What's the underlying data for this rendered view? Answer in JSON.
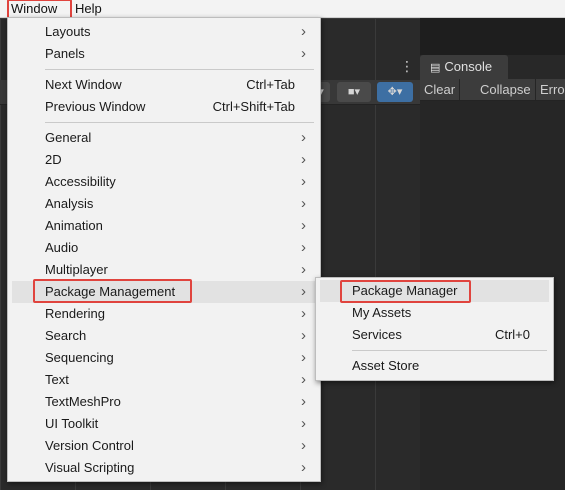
{
  "menubar": {
    "items": [
      "Window",
      "Help"
    ]
  },
  "window_menu": {
    "groups": [
      [
        {
          "label": "Layouts",
          "submenu": true
        },
        {
          "label": "Panels",
          "submenu": true
        }
      ],
      [
        {
          "label": "Next Window",
          "shortcut": "Ctrl+Tab"
        },
        {
          "label": "Previous Window",
          "shortcut": "Ctrl+Shift+Tab"
        }
      ],
      [
        {
          "label": "General",
          "submenu": true
        },
        {
          "label": "2D",
          "submenu": true
        },
        {
          "label": "Accessibility",
          "submenu": true
        },
        {
          "label": "Analysis",
          "submenu": true
        },
        {
          "label": "Animation",
          "submenu": true
        },
        {
          "label": "Audio",
          "submenu": true
        },
        {
          "label": "Multiplayer",
          "submenu": true
        },
        {
          "label": "Package Management",
          "submenu": true,
          "highlighted": true
        },
        {
          "label": "Rendering",
          "submenu": true
        },
        {
          "label": "Search",
          "submenu": true
        },
        {
          "label": "Sequencing",
          "submenu": true
        },
        {
          "label": "Text",
          "submenu": true
        },
        {
          "label": "TextMeshPro",
          "submenu": true
        },
        {
          "label": "UI Toolkit",
          "submenu": true
        },
        {
          "label": "Version Control",
          "submenu": true
        },
        {
          "label": "Visual Scripting",
          "submenu": true
        }
      ]
    ]
  },
  "package_submenu": {
    "groups": [
      [
        {
          "label": "Package Manager",
          "highlighted": true
        },
        {
          "label": "My Assets"
        },
        {
          "label": "Services",
          "shortcut": "Ctrl+0"
        }
      ],
      [
        {
          "label": "Asset Store"
        }
      ]
    ]
  },
  "console": {
    "tab_label": "Console",
    "tab_icon": "console-list-icon",
    "toolbar": [
      "Clear",
      "Collapse",
      "Error"
    ]
  },
  "annotation_color": "#e0443e"
}
